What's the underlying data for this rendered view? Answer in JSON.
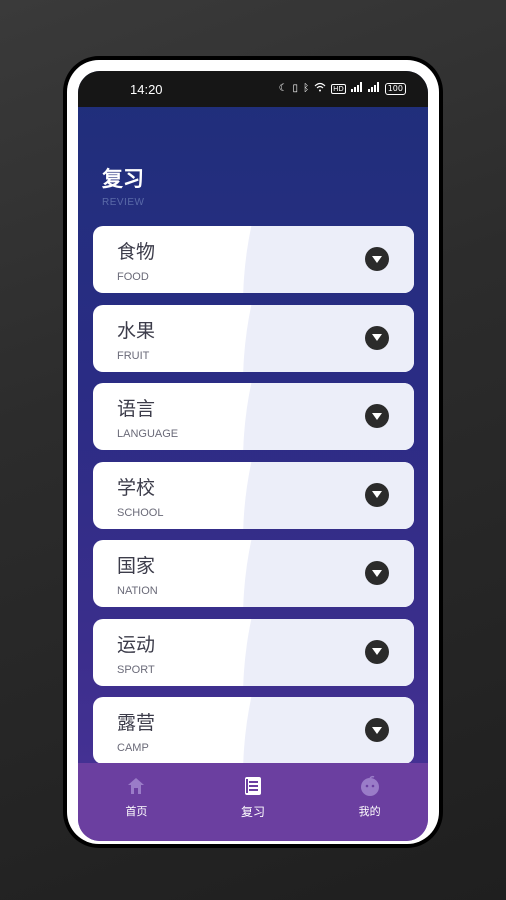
{
  "status_bar": {
    "time": "14:20",
    "battery": "100"
  },
  "header": {
    "title": "复习",
    "subtitle": "REVIEW"
  },
  "categories": [
    {
      "zh": "食物",
      "en": "FOOD"
    },
    {
      "zh": "水果",
      "en": "FRUIT"
    },
    {
      "zh": "语言",
      "en": "LANGUAGE"
    },
    {
      "zh": "学校",
      "en": "SCHOOL"
    },
    {
      "zh": "国家",
      "en": "NATION"
    },
    {
      "zh": "运动",
      "en": "SPORT"
    },
    {
      "zh": "露营",
      "en": "CAMP"
    }
  ],
  "tabbar": {
    "tabs": [
      {
        "label": "首页",
        "icon": "home-icon"
      },
      {
        "label": "复习",
        "icon": "book-icon",
        "active": true
      },
      {
        "label": "我的",
        "icon": "profile-icon"
      }
    ]
  },
  "colors": {
    "tab_bg": "#6b3fa0",
    "screen_top": "#1f2f7a",
    "screen_bottom": "#4a3398"
  }
}
